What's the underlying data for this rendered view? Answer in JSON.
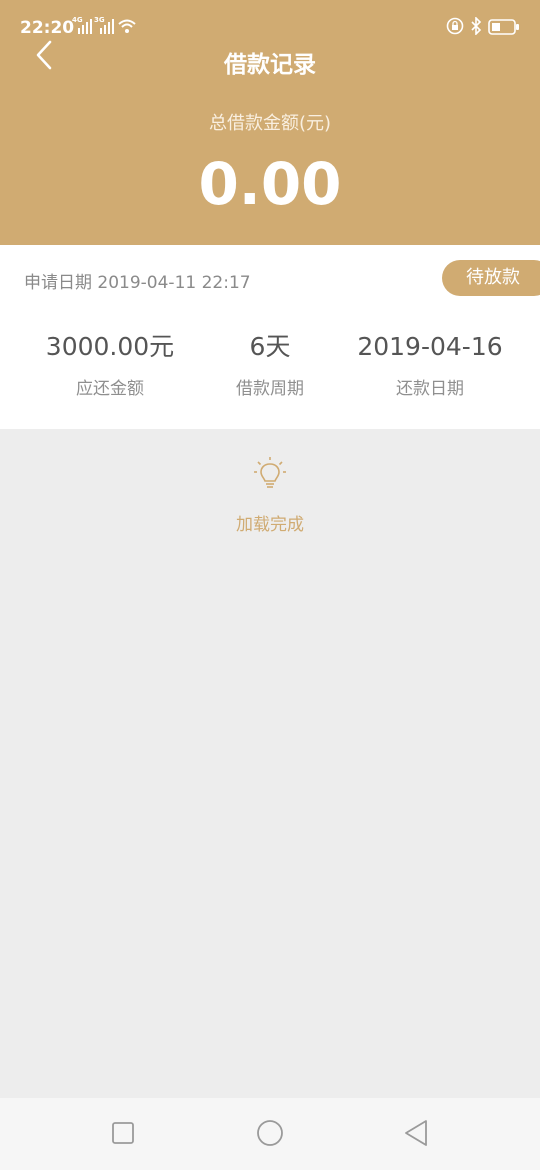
{
  "status_bar": {
    "time": "22:20",
    "network_1": "4G",
    "network_2": "3G"
  },
  "header": {
    "title": "借款记录",
    "total_label": "总借款金额(元)",
    "total_amount": "0.00"
  },
  "record": {
    "apply_date": "申请日期 2019-04-11 22:17",
    "status": "待放款",
    "columns": [
      {
        "value": "3000.00元",
        "label": "应还金额"
      },
      {
        "value": "6天",
        "label": "借款周期"
      },
      {
        "value": "2019-04-16",
        "label": "还款日期"
      }
    ]
  },
  "footer": {
    "loaded_text": "加载完成"
  },
  "colors": {
    "accent": "#d0ab72",
    "background": "#ededed"
  },
  "icons": [
    "back-arrow-icon",
    "lightbulb-icon",
    "recent-apps-icon",
    "home-icon",
    "back-triangle-icon"
  ]
}
